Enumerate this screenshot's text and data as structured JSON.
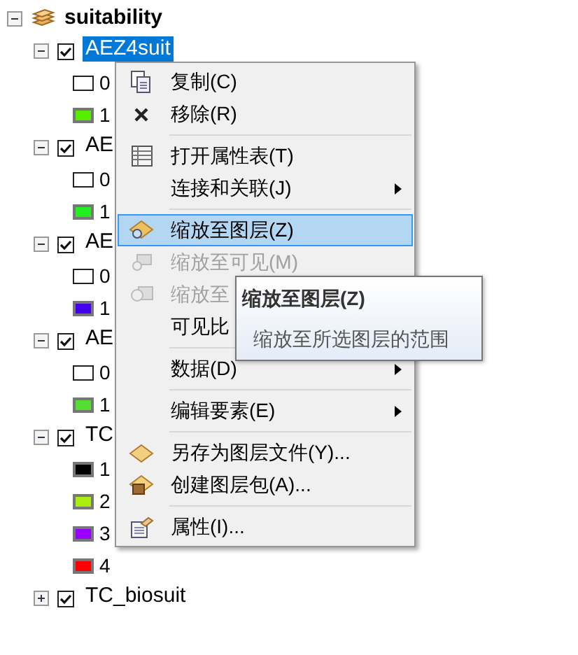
{
  "tree": {
    "label": "suitability",
    "expanded": true,
    "layers": [
      {
        "label": "AEZ4suit",
        "checked": true,
        "expanded": true,
        "selected": true,
        "legend": [
          {
            "label": "0",
            "color": "#ffffff"
          },
          {
            "label": "1",
            "color": "#55ee00"
          }
        ]
      },
      {
        "label": "AE",
        "checked": true,
        "expanded": true,
        "selected": false,
        "legend": [
          {
            "label": "0",
            "color": "#ffffff"
          },
          {
            "label": "1",
            "color": "#22ee22"
          }
        ]
      },
      {
        "label": "AE",
        "checked": true,
        "expanded": true,
        "selected": false,
        "legend": [
          {
            "label": "0",
            "color": "#ffffff"
          },
          {
            "label": "1",
            "color": "#4400ee"
          }
        ]
      },
      {
        "label": "AE",
        "checked": true,
        "expanded": true,
        "selected": false,
        "legend": [
          {
            "label": "0",
            "color": "#ffffff"
          },
          {
            "label": "1",
            "color": "#55dd33"
          }
        ]
      },
      {
        "label": "TC",
        "checked": true,
        "expanded": true,
        "selected": false,
        "legend": [
          {
            "label": "1",
            "color": "#000000"
          },
          {
            "label": "2",
            "color": "#aaee11"
          },
          {
            "label": "3",
            "color": "#9900ff"
          },
          {
            "label": "4",
            "color": "#ff0000"
          }
        ]
      },
      {
        "label": "TC_biosuit",
        "checked": true,
        "expanded": false,
        "selected": false
      }
    ]
  },
  "context_menu": [
    {
      "kind": "item",
      "label": "复制(C)",
      "disabled": false,
      "selected": false,
      "submenu": false
    },
    {
      "kind": "item",
      "label": "移除(R)",
      "disabled": false,
      "selected": false,
      "submenu": false
    },
    {
      "kind": "separator"
    },
    {
      "kind": "item",
      "label": "打开属性表(T)",
      "disabled": false,
      "selected": false,
      "submenu": false
    },
    {
      "kind": "item",
      "label": "连接和关联(J)",
      "disabled": false,
      "selected": false,
      "submenu": true
    },
    {
      "kind": "separator"
    },
    {
      "kind": "item",
      "label": "缩放至图层(Z)",
      "disabled": false,
      "selected": true,
      "submenu": false
    },
    {
      "kind": "item",
      "label": "缩放至可见(M)",
      "disabled": true,
      "selected": false,
      "submenu": false
    },
    {
      "kind": "item",
      "label": "缩放至",
      "disabled": true,
      "selected": false,
      "submenu": false
    },
    {
      "kind": "item",
      "label": "可见比",
      "disabled": false,
      "selected": false
    },
    {
      "kind": "separator"
    },
    {
      "kind": "item",
      "label": "数据(D)",
      "disabled": false,
      "selected": false,
      "submenu": true
    },
    {
      "kind": "separator"
    },
    {
      "kind": "item",
      "label": "编辑要素(E)",
      "disabled": false,
      "selected": false,
      "submenu": true
    },
    {
      "kind": "separator"
    },
    {
      "kind": "item",
      "label": "另存为图层文件(Y)...",
      "disabled": false,
      "selected": false,
      "submenu": false
    },
    {
      "kind": "item",
      "label": "创建图层包(A)...",
      "disabled": false,
      "selected": false,
      "submenu": false
    },
    {
      "kind": "separator"
    },
    {
      "kind": "item",
      "label": "属性(I)...",
      "disabled": false,
      "selected": false,
      "submenu": false
    }
  ],
  "tooltip": {
    "title": "缩放至图层(Z)",
    "description": "缩放至所选图层的范围"
  }
}
